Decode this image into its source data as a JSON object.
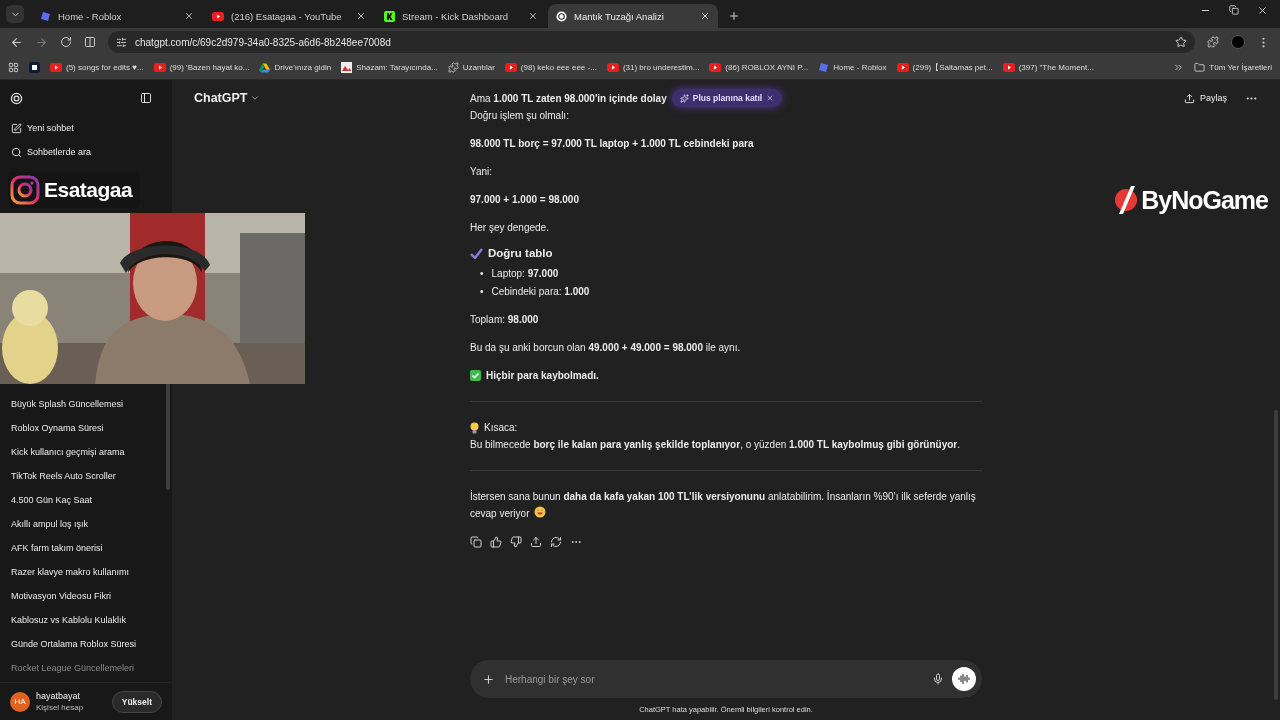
{
  "browser": {
    "tabs": [
      {
        "title": "Home - Roblox",
        "selected": false
      },
      {
        "title": "(216) Esatagaa - YouTube",
        "selected": false
      },
      {
        "title": "Stream - Kick Dashboard",
        "selected": false
      },
      {
        "title": "Mantık Tuzağı Analizi",
        "selected": true
      }
    ],
    "address": "chatgpt.com/c/69c2d979-34a0-8325-a6d6-8b248ee7008d",
    "bookmarks": [
      {
        "label": "(5) songs for edits ♥..."
      },
      {
        "label": "(99) 'Bazen hayat ko..."
      },
      {
        "label": "Drive'ınıza gidin"
      },
      {
        "label": "Shazam: Tarayıcında..."
      },
      {
        "label": "Uzantılar"
      },
      {
        "label": "(98) keko eee eee -..."
      },
      {
        "label": "(31) bro underestim..."
      },
      {
        "label": "(86) ROBLOX AYNI P..."
      },
      {
        "label": "Home - Roblox"
      },
      {
        "label": "(299)【Saitamas pet..."
      },
      {
        "label": "(397) \"The Moment..."
      }
    ],
    "all_bookmarks": "Tüm Yer İşaretleri"
  },
  "sidebar": {
    "actions": [
      {
        "label": "Yeni sohbet"
      },
      {
        "label": "Sohbetlerde ara"
      }
    ],
    "chats": [
      {
        "title": "Büyük Splash Güncellemesi"
      },
      {
        "title": "Roblox Oynama Süresi"
      },
      {
        "title": "Kick kullanıcı geçmişi arama"
      },
      {
        "title": "TikTok Reels Auto Scroller"
      },
      {
        "title": "4.500 Gün Kaç Saat"
      },
      {
        "title": "Akıllı ampul loş ışık"
      },
      {
        "title": "AFK farm takım önerisi"
      },
      {
        "title": "Razer klavye makro kullanımı"
      },
      {
        "title": "Motivasyon Videosu Fikri"
      },
      {
        "title": "Kablosuz vs Kablolu Kulaklık"
      },
      {
        "title": "Günde Ortalama Roblox Süresi"
      },
      {
        "title": "Rocket League Güncellemeleri"
      }
    ],
    "user": {
      "initials": "HA",
      "name": "hayatbayat",
      "plan": "Kişisel hesap",
      "upgrade": "Yükselt"
    }
  },
  "header": {
    "model": "ChatGPT",
    "share": "Paylaş",
    "plus_pill": "Plus planına katıl"
  },
  "message": [
    {
      "kind": "paragraph",
      "lines": [
        {
          "text": "Ama **1.000 TL zaten 98.000'in içinde dolay**"
        },
        {
          "text": "Doğru işlem şu olmalı:"
        }
      ]
    },
    {
      "kind": "paragraph",
      "lines": [
        {
          "text": "98.000 TL borç = 97.000 TL laptop + 1.000 TL cebindeki para",
          "bold": true
        }
      ]
    },
    {
      "kind": "paragraph",
      "lines": [
        {
          "text": "Yani:"
        }
      ]
    },
    {
      "kind": "paragraph",
      "lines": [
        {
          "text": "97.000 + 1.000 = 98.000",
          "bold": true
        }
      ]
    },
    {
      "kind": "paragraph",
      "lines": [
        {
          "text": "Her şey dengede."
        }
      ]
    },
    {
      "kind": "heading",
      "text": "Doğru tablo"
    },
    {
      "kind": "bullets",
      "marker": "•",
      "items": [
        "Laptop: **97.000**",
        "Cebindeki para: **1.000**"
      ]
    },
    {
      "kind": "paragraph",
      "lines": [
        {
          "text": "Toplam: **98.000**"
        }
      ]
    },
    {
      "kind": "paragraph",
      "lines": [
        {
          "text": "Bu da şu anki borcun olan **49.000 + 49.000 = 98.000** ile aynı."
        }
      ]
    },
    {
      "kind": "done",
      "lines": [
        {
          "text": "Hiçbir para kaybolmadı.",
          "bold": true
        }
      ]
    },
    {
      "kind": "divider"
    },
    {
      "kind": "tip",
      "lines": [
        {
          "text": "Kısaca:"
        },
        {
          "text": "Bu bilmecede **borç ile kalan para yanlış şekilde toplanıyor**, o yüzden **1.000 TL kaybolmuş gibi görünüyor**."
        }
      ]
    },
    {
      "kind": "divider"
    },
    {
      "kind": "closing",
      "lines": [
        {
          "text": "İstersen sana bunun **daha da kafa yakan 100 TL’lik versiyonunu** anlatabilirim. İnsanların %90’ı ilk seferde yanlış cevap veriyor"
        }
      ]
    }
  ],
  "composer": {
    "placeholder": "Herhangi bir şey sor",
    "disclaimer": "ChatGPT hata yapabilir. Önemli bilgileri kontrol edin."
  },
  "stream_overlay": {
    "channel": "Esatagaa",
    "sponsor": "ByNoGame"
  }
}
